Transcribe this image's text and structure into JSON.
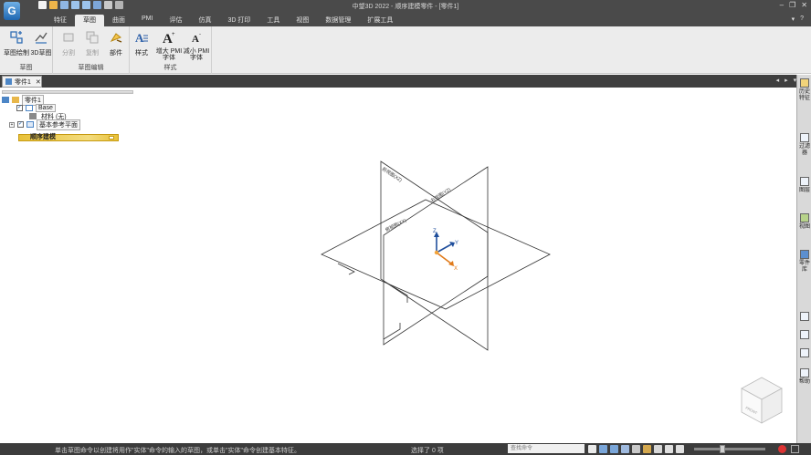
{
  "window": {
    "title": "中望3D 2022 - 顺序建模零件 - [零件1]",
    "logo_letter": "G"
  },
  "ribbon_tabs": [
    "特征",
    "草图",
    "曲面",
    "PMI",
    "评估",
    "仿真",
    "3D 打印",
    "工具",
    "视图",
    "数据管理",
    "扩展工具"
  ],
  "active_tab": "草图",
  "ribbon": {
    "group_sketch": {
      "title": "草图",
      "buttons": [
        "草图绘制",
        "3D草图"
      ]
    },
    "group_sketch_edit": {
      "title": "草图编辑",
      "buttons": [
        "分割",
        "复制",
        "插入",
        "部件"
      ]
    },
    "group_style": {
      "title": "样式",
      "buttons": [
        "样式",
        "增大 PMI 字体",
        "减小 PMI 字体"
      ]
    }
  },
  "document_tab": "零件1",
  "tree": {
    "root": "零件1",
    "items": [
      {
        "label": "Base"
      },
      {
        "label": "材料 (无)"
      },
      {
        "label": "基本参考平面"
      }
    ],
    "history": "顺序建模"
  },
  "viewport": {
    "plane_labels": [
      "前视图(XZ)",
      "右视图(YZ)",
      "俯视图(XY)"
    ],
    "axes": [
      "X",
      "Y",
      "Z"
    ],
    "view_cube_label": "FRONT"
  },
  "right_dock": [
    "历史特征",
    "过滤器",
    "图层",
    "视图",
    "零件库",
    "帮助"
  ],
  "status": {
    "message": "单击草图命令以创建将用作\"实体\"命令的输入的草图，或单击\"实体\"命令创建基本特征。",
    "selection": "选择了 0 项",
    "command_placeholder": "查找命令"
  },
  "colors": {
    "chrome_dark": "#4a4a4a",
    "ribbon_bg": "#ececec",
    "history_bar": "#e8c13a",
    "axis_x": "#e07a1a",
    "axis_y": "#1f4e9c",
    "axis_z": "#1f4e9c"
  }
}
